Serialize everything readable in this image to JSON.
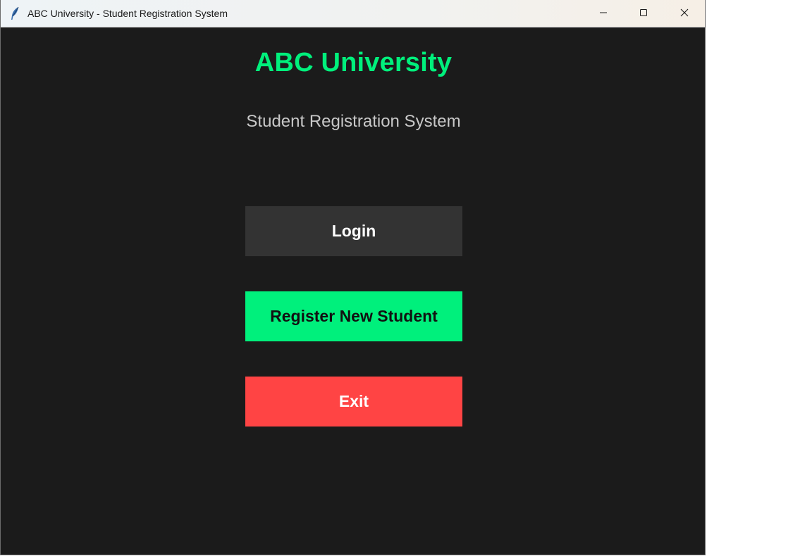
{
  "window": {
    "title": "ABC University - Student Registration System",
    "icons": {
      "app": "feather-icon",
      "minimize": "minimize-icon",
      "maximize": "maximize-icon",
      "close": "close-icon"
    }
  },
  "main": {
    "title": "ABC University",
    "subtitle": "Student Registration System",
    "buttons": {
      "login": "Login",
      "register": "Register New Student",
      "exit": "Exit"
    }
  },
  "colors": {
    "background": "#1b1b1b",
    "accent_green": "#00f07c",
    "login_button": "#333333",
    "exit_button": "#ff4444",
    "subtitle_text": "#c8c8c8"
  }
}
